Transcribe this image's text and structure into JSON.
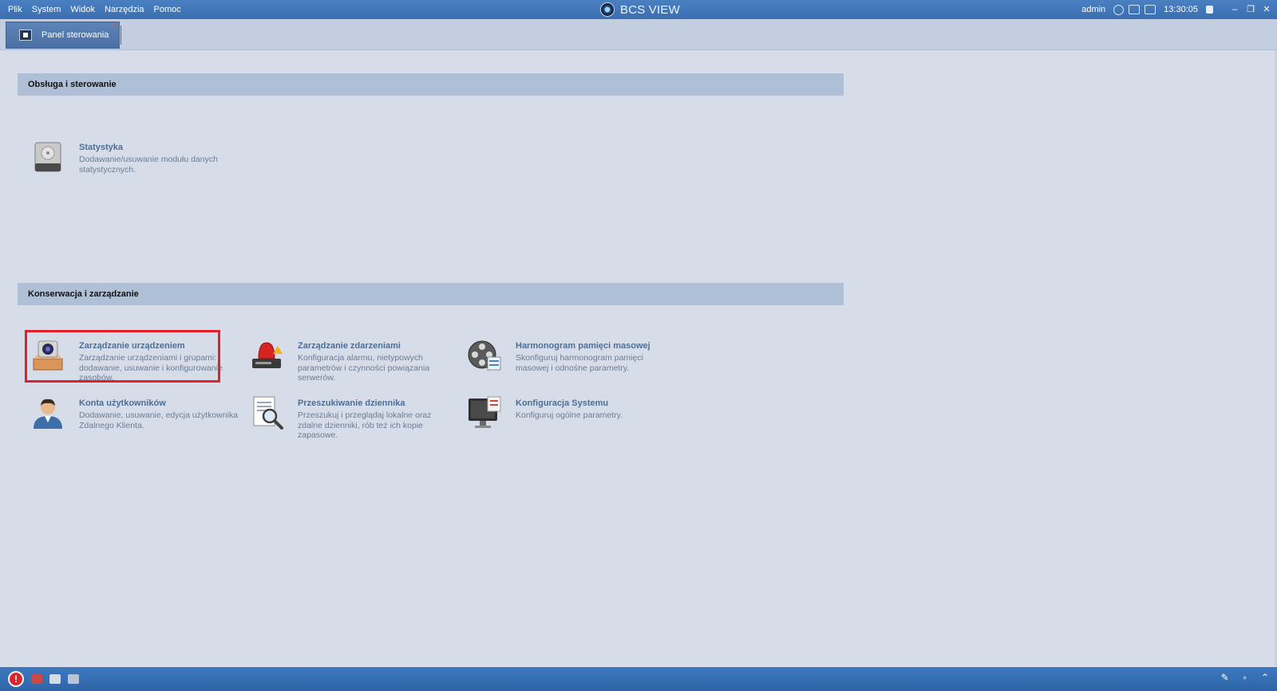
{
  "menu": [
    "Plik",
    "System",
    "Widok",
    "Narzędzia",
    "Pomoc"
  ],
  "app_title": "BCS VIEW",
  "tray": {
    "user": "admin",
    "clock": "13:30:05"
  },
  "window_buttons": {
    "minimize": "–",
    "restore": "❐",
    "close": "✕"
  },
  "tab": {
    "label": "Panel sterowania",
    "close": "✕"
  },
  "sections": [
    {
      "title": "Obsługa i sterowanie",
      "items": [
        {
          "title": "Statystyka",
          "desc": "Dodawanie/usuwanie modułu danych statystycznych.",
          "icon": "hard-drive-icon"
        }
      ]
    },
    {
      "title": "Konserwacja i zarządzanie",
      "items": [
        {
          "title": "Zarządzanie urządzeniem",
          "desc": "Zarządzanie urządzeniami i grupami: dodawanie, usuwanie i konfigurowanie zasobów.",
          "icon": "device-camera-icon",
          "highlighted": true
        },
        {
          "title": "Zarządzanie zdarzeniami",
          "desc": "Konfiguracja alarmu, nietypowych parametrów i czynności powiązania serwerów.",
          "icon": "alarm-siren-icon"
        },
        {
          "title": "Harmonogram pamięci masowej",
          "desc": "Skonfiguruj harmonogram pamięci masowej i odnośne parametry.",
          "icon": "film-reel-schedule-icon"
        },
        {
          "title": "Konta użytkowników",
          "desc": "Dodawanie, usuwanie, edycja użytkownika Zdalnego Klienta.",
          "icon": "user-icon"
        },
        {
          "title": "Przeszukiwanie dziennika",
          "desc": "Przeszukuj i przeglądaj lokalne oraz zdalne dzienniki, rób też ich kopie zapasowe.",
          "icon": "log-search-icon"
        },
        {
          "title": "Konfiguracja Systemu",
          "desc": "Konfiguruj ogólne parametry.",
          "icon": "system-monitor-icon"
        }
      ]
    }
  ],
  "colors": {
    "titlebar": "#3a6eb0",
    "section_header": "#afbfd6",
    "item_title": "#4d6e97",
    "highlight": "#e0212b"
  }
}
